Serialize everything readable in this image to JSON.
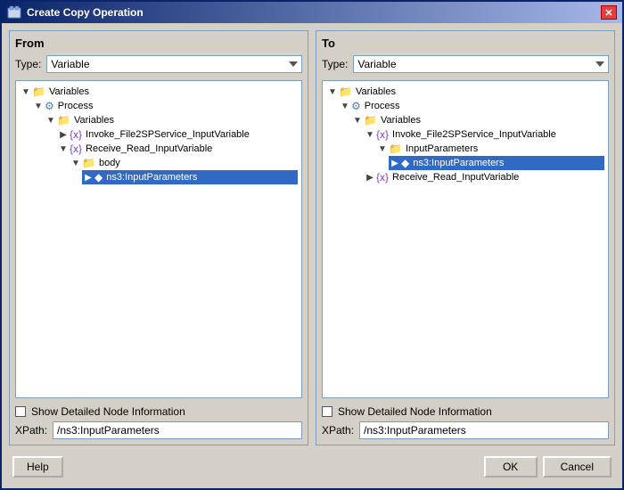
{
  "window": {
    "title": "Create Copy Operation",
    "icon": "📋"
  },
  "from_panel": {
    "title": "From",
    "type_label": "Type:",
    "type_value": "Variable",
    "tree": {
      "items": [
        {
          "id": "variables-root",
          "label": "Variables",
          "level": 0,
          "icon": "folder",
          "expanded": true
        },
        {
          "id": "process",
          "label": "Process",
          "level": 1,
          "icon": "process",
          "expanded": true
        },
        {
          "id": "variables-child",
          "label": "Variables",
          "level": 2,
          "icon": "folder",
          "expanded": true
        },
        {
          "id": "invoke-file",
          "label": "Invoke_File2SPService_InputVariable",
          "level": 3,
          "icon": "var",
          "expanded": false
        },
        {
          "id": "receive-read",
          "label": "Receive_Read_InputVariable",
          "level": 3,
          "icon": "var",
          "expanded": true
        },
        {
          "id": "body",
          "label": "body",
          "level": 4,
          "icon": "folder",
          "expanded": true
        },
        {
          "id": "ns3-input",
          "label": "ns3:InputParameters",
          "level": 5,
          "icon": "diamond",
          "expanded": false,
          "selected": true
        }
      ]
    },
    "show_detail_label": "Show Detailed Node Information",
    "xpath_label": "XPath:",
    "xpath_value": "/ns3:InputParameters"
  },
  "to_panel": {
    "title": "To",
    "type_label": "Type:",
    "type_value": "Variable",
    "tree": {
      "items": [
        {
          "id": "variables-root-t",
          "label": "Variables",
          "level": 0,
          "icon": "folder",
          "expanded": true
        },
        {
          "id": "process-t",
          "label": "Process",
          "level": 1,
          "icon": "process",
          "expanded": true
        },
        {
          "id": "variables-child-t",
          "label": "Variables",
          "level": 2,
          "icon": "folder",
          "expanded": true
        },
        {
          "id": "invoke-file-t",
          "label": "Invoke_File2SPService_InputVariable",
          "level": 3,
          "icon": "var",
          "expanded": true
        },
        {
          "id": "input-params-t",
          "label": "InputParameters",
          "level": 4,
          "icon": "folder",
          "expanded": true
        },
        {
          "id": "ns3-input-t",
          "label": "ns3:InputParameters",
          "level": 5,
          "icon": "diamond",
          "expanded": false,
          "selected": false
        },
        {
          "id": "receive-read-t",
          "label": "Receive_Read_InputVariable",
          "level": 3,
          "icon": "var",
          "expanded": false
        }
      ]
    },
    "show_detail_label": "Show Detailed Node Information",
    "xpath_label": "XPath:",
    "xpath_value": "/ns3:InputParameters"
  },
  "buttons": {
    "help": "Help",
    "ok": "OK",
    "cancel": "Cancel"
  }
}
